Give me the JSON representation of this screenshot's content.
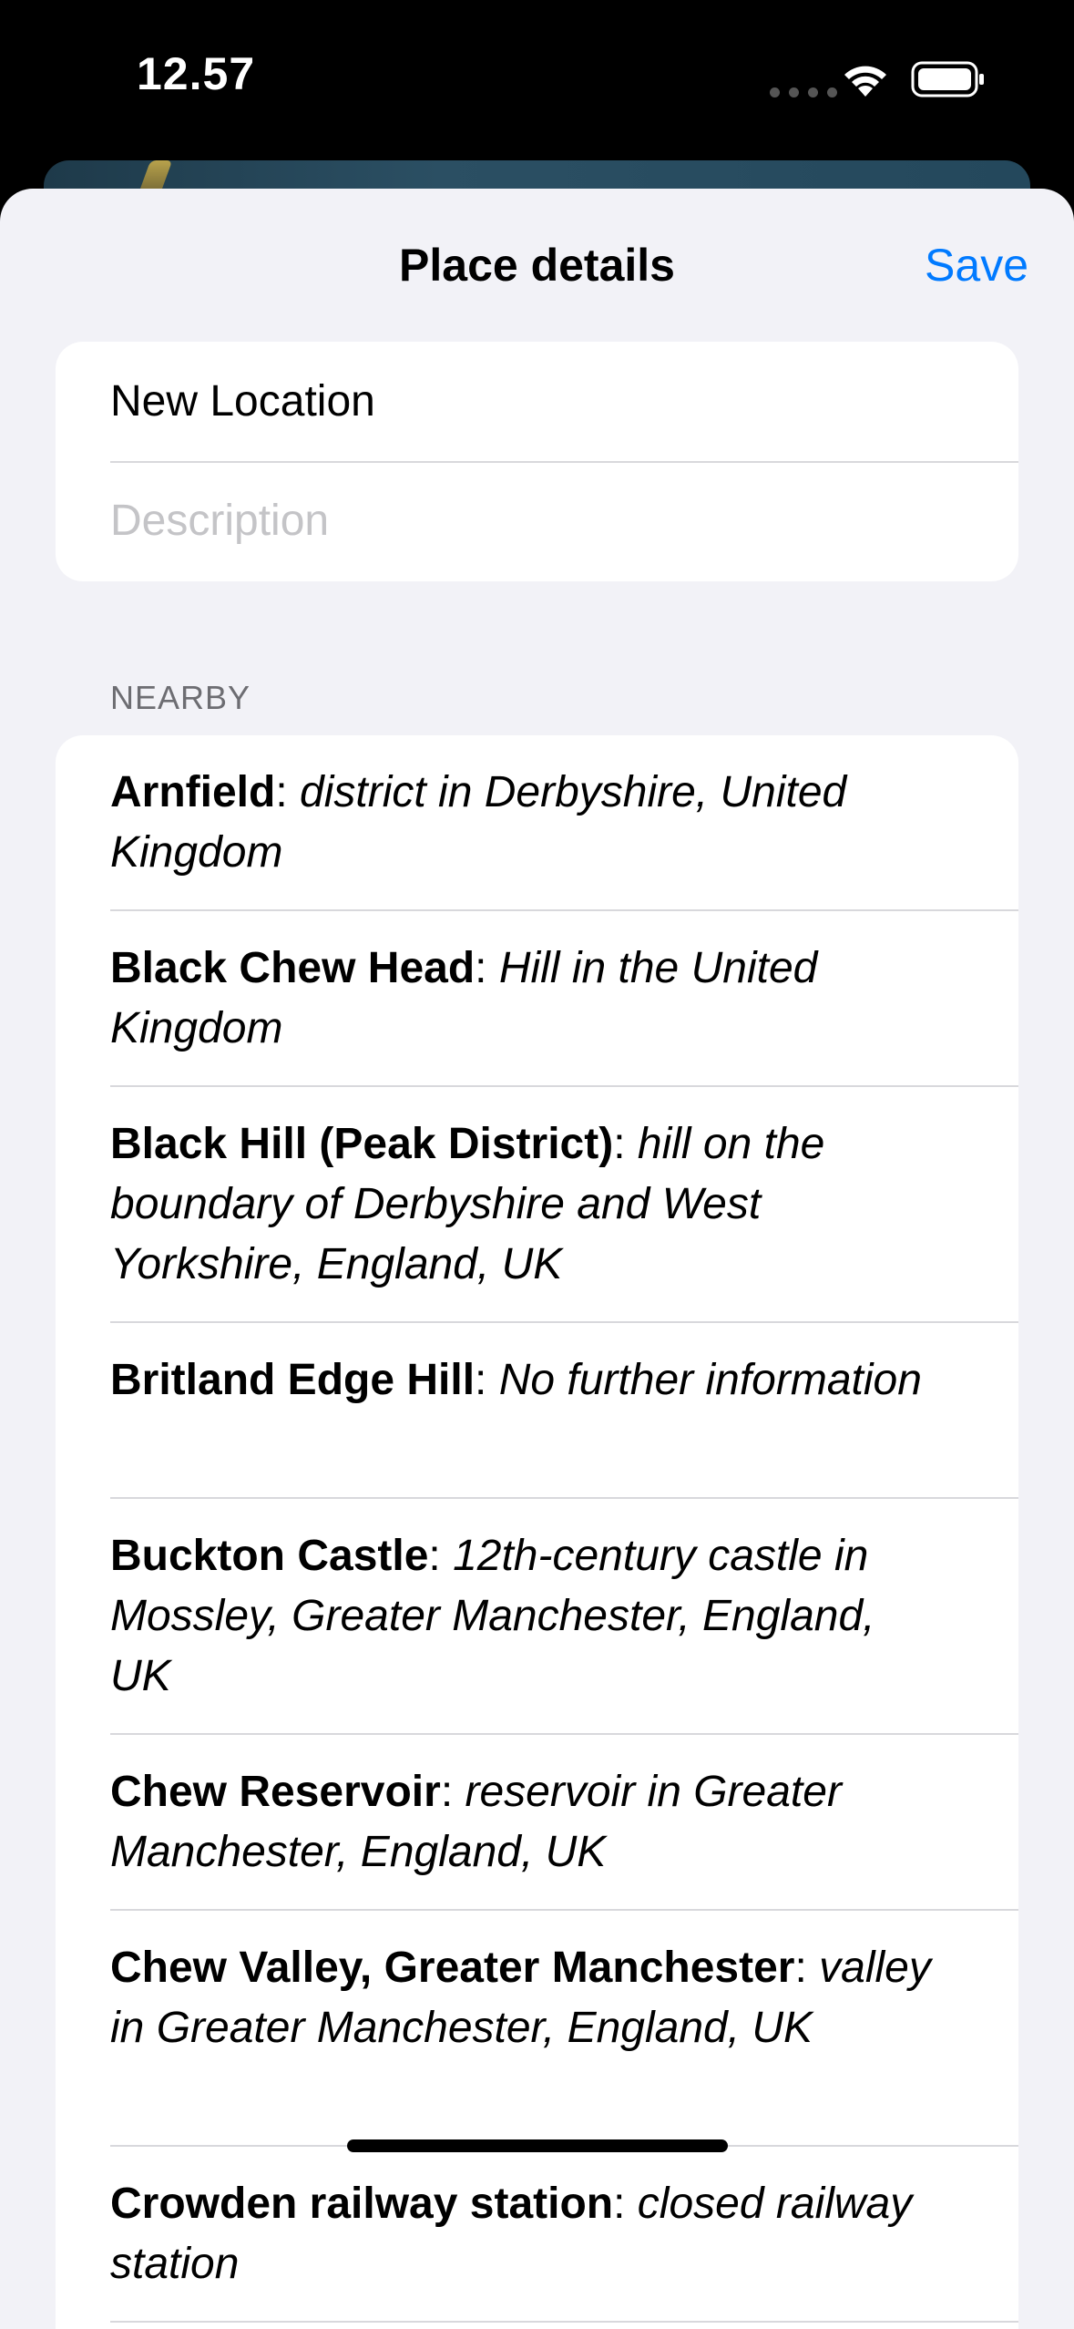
{
  "status_bar": {
    "time": "12.57"
  },
  "nav": {
    "title": "Place details",
    "save_label": "Save"
  },
  "form": {
    "name_value": "New Location",
    "description_placeholder": "Description"
  },
  "nearby": {
    "header": "NEARBY",
    "items": [
      {
        "name": "Arnfield",
        "desc": "district in Derbyshire, United Kingdom"
      },
      {
        "name": "Black Chew Head",
        "desc": "Hill in the United Kingdom"
      },
      {
        "name": "Black Hill (Peak District)",
        "desc": "hill on the boundary of Derbyshire and West Yorkshire, England, UK"
      },
      {
        "name": "Britland Edge Hill",
        "desc": "No further information"
      },
      {
        "name": "Buckton Castle",
        "desc": "12th-century castle in Mossley, Greater Manchester, England, UK"
      },
      {
        "name": "Chew Reservoir",
        "desc": "reservoir in Greater Manchester, England, UK"
      },
      {
        "name": "Chew Valley, Greater Manchester",
        "desc": "valley in Greater Manchester, England, UK"
      },
      {
        "name": "Crowden railway station",
        "desc": "closed railway station"
      }
    ]
  },
  "colors": {
    "accent": "#007aff",
    "sheet_background": "#f2f2f7",
    "placeholder": "#c4c4c7"
  },
  "icons": [
    "wifi-icon",
    "battery-icon",
    "cellular-signal-icon"
  ]
}
